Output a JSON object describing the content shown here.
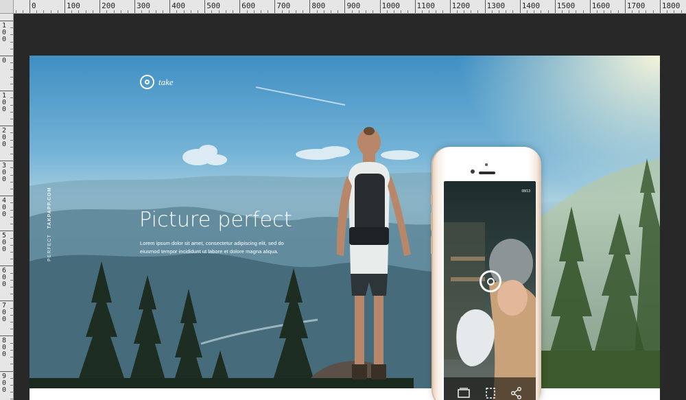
{
  "ruler": {
    "top_labels": [
      "0",
      "100",
      "200",
      "300",
      "400",
      "500",
      "600",
      "700",
      "800",
      "900",
      "1000",
      "1100",
      "1200",
      "1300",
      "1400",
      "1500",
      "1600",
      "1700",
      "1800"
    ],
    "left_labels": [
      "100",
      "0",
      "100",
      "200",
      "300",
      "400",
      "500",
      "600",
      "700",
      "800",
      "900"
    ]
  },
  "page": {
    "brand": "take",
    "side_label_light": "PERFECT",
    "side_label_bold": "TAKPAPP.COM",
    "title": "Picture perfect",
    "body": "Lorem ipsum dolor sit amet, consectetur adipiscing elit, sed do eiusmod tempor incididunt ut labore et dolore magna aliqua."
  },
  "phone": {
    "screen_time": "08/13",
    "icons": [
      "gallery-icon",
      "crop-icon",
      "share-icon"
    ]
  },
  "colors": {
    "canvas_bg": "#282828",
    "ruler_bg": "#e6e6e6",
    "text": "#ffffff",
    "phone_gold": "#e8d3bf"
  }
}
